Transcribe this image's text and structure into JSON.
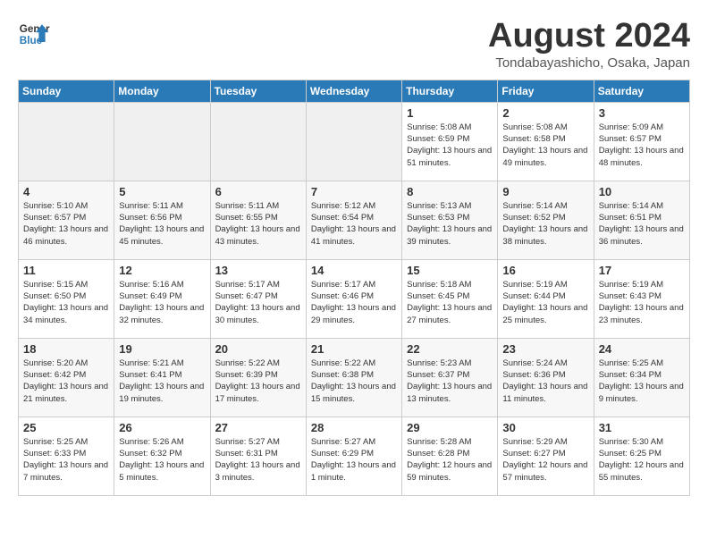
{
  "header": {
    "logo_line1": "General",
    "logo_line2": "Blue",
    "month_title": "August 2024",
    "location": "Tondabayashicho, Osaka, Japan"
  },
  "weekdays": [
    "Sunday",
    "Monday",
    "Tuesday",
    "Wednesday",
    "Thursday",
    "Friday",
    "Saturday"
  ],
  "weeks": [
    [
      {
        "day": "",
        "empty": true
      },
      {
        "day": "",
        "empty": true
      },
      {
        "day": "",
        "empty": true
      },
      {
        "day": "",
        "empty": true
      },
      {
        "day": "1",
        "sunrise": "Sunrise: 5:08 AM",
        "sunset": "Sunset: 6:59 PM",
        "daylight": "Daylight: 13 hours and 51 minutes."
      },
      {
        "day": "2",
        "sunrise": "Sunrise: 5:08 AM",
        "sunset": "Sunset: 6:58 PM",
        "daylight": "Daylight: 13 hours and 49 minutes."
      },
      {
        "day": "3",
        "sunrise": "Sunrise: 5:09 AM",
        "sunset": "Sunset: 6:57 PM",
        "daylight": "Daylight: 13 hours and 48 minutes."
      }
    ],
    [
      {
        "day": "4",
        "sunrise": "Sunrise: 5:10 AM",
        "sunset": "Sunset: 6:57 PM",
        "daylight": "Daylight: 13 hours and 46 minutes."
      },
      {
        "day": "5",
        "sunrise": "Sunrise: 5:11 AM",
        "sunset": "Sunset: 6:56 PM",
        "daylight": "Daylight: 13 hours and 45 minutes."
      },
      {
        "day": "6",
        "sunrise": "Sunrise: 5:11 AM",
        "sunset": "Sunset: 6:55 PM",
        "daylight": "Daylight: 13 hours and 43 minutes."
      },
      {
        "day": "7",
        "sunrise": "Sunrise: 5:12 AM",
        "sunset": "Sunset: 6:54 PM",
        "daylight": "Daylight: 13 hours and 41 minutes."
      },
      {
        "day": "8",
        "sunrise": "Sunrise: 5:13 AM",
        "sunset": "Sunset: 6:53 PM",
        "daylight": "Daylight: 13 hours and 39 minutes."
      },
      {
        "day": "9",
        "sunrise": "Sunrise: 5:14 AM",
        "sunset": "Sunset: 6:52 PM",
        "daylight": "Daylight: 13 hours and 38 minutes."
      },
      {
        "day": "10",
        "sunrise": "Sunrise: 5:14 AM",
        "sunset": "Sunset: 6:51 PM",
        "daylight": "Daylight: 13 hours and 36 minutes."
      }
    ],
    [
      {
        "day": "11",
        "sunrise": "Sunrise: 5:15 AM",
        "sunset": "Sunset: 6:50 PM",
        "daylight": "Daylight: 13 hours and 34 minutes."
      },
      {
        "day": "12",
        "sunrise": "Sunrise: 5:16 AM",
        "sunset": "Sunset: 6:49 PM",
        "daylight": "Daylight: 13 hours and 32 minutes."
      },
      {
        "day": "13",
        "sunrise": "Sunrise: 5:17 AM",
        "sunset": "Sunset: 6:47 PM",
        "daylight": "Daylight: 13 hours and 30 minutes."
      },
      {
        "day": "14",
        "sunrise": "Sunrise: 5:17 AM",
        "sunset": "Sunset: 6:46 PM",
        "daylight": "Daylight: 13 hours and 29 minutes."
      },
      {
        "day": "15",
        "sunrise": "Sunrise: 5:18 AM",
        "sunset": "Sunset: 6:45 PM",
        "daylight": "Daylight: 13 hours and 27 minutes."
      },
      {
        "day": "16",
        "sunrise": "Sunrise: 5:19 AM",
        "sunset": "Sunset: 6:44 PM",
        "daylight": "Daylight: 13 hours and 25 minutes."
      },
      {
        "day": "17",
        "sunrise": "Sunrise: 5:19 AM",
        "sunset": "Sunset: 6:43 PM",
        "daylight": "Daylight: 13 hours and 23 minutes."
      }
    ],
    [
      {
        "day": "18",
        "sunrise": "Sunrise: 5:20 AM",
        "sunset": "Sunset: 6:42 PM",
        "daylight": "Daylight: 13 hours and 21 minutes."
      },
      {
        "day": "19",
        "sunrise": "Sunrise: 5:21 AM",
        "sunset": "Sunset: 6:41 PM",
        "daylight": "Daylight: 13 hours and 19 minutes."
      },
      {
        "day": "20",
        "sunrise": "Sunrise: 5:22 AM",
        "sunset": "Sunset: 6:39 PM",
        "daylight": "Daylight: 13 hours and 17 minutes."
      },
      {
        "day": "21",
        "sunrise": "Sunrise: 5:22 AM",
        "sunset": "Sunset: 6:38 PM",
        "daylight": "Daylight: 13 hours and 15 minutes."
      },
      {
        "day": "22",
        "sunrise": "Sunrise: 5:23 AM",
        "sunset": "Sunset: 6:37 PM",
        "daylight": "Daylight: 13 hours and 13 minutes."
      },
      {
        "day": "23",
        "sunrise": "Sunrise: 5:24 AM",
        "sunset": "Sunset: 6:36 PM",
        "daylight": "Daylight: 13 hours and 11 minutes."
      },
      {
        "day": "24",
        "sunrise": "Sunrise: 5:25 AM",
        "sunset": "Sunset: 6:34 PM",
        "daylight": "Daylight: 13 hours and 9 minutes."
      }
    ],
    [
      {
        "day": "25",
        "sunrise": "Sunrise: 5:25 AM",
        "sunset": "Sunset: 6:33 PM",
        "daylight": "Daylight: 13 hours and 7 minutes."
      },
      {
        "day": "26",
        "sunrise": "Sunrise: 5:26 AM",
        "sunset": "Sunset: 6:32 PM",
        "daylight": "Daylight: 13 hours and 5 minutes."
      },
      {
        "day": "27",
        "sunrise": "Sunrise: 5:27 AM",
        "sunset": "Sunset: 6:31 PM",
        "daylight": "Daylight: 13 hours and 3 minutes."
      },
      {
        "day": "28",
        "sunrise": "Sunrise: 5:27 AM",
        "sunset": "Sunset: 6:29 PM",
        "daylight": "Daylight: 13 hours and 1 minute."
      },
      {
        "day": "29",
        "sunrise": "Sunrise: 5:28 AM",
        "sunset": "Sunset: 6:28 PM",
        "daylight": "Daylight: 12 hours and 59 minutes."
      },
      {
        "day": "30",
        "sunrise": "Sunrise: 5:29 AM",
        "sunset": "Sunset: 6:27 PM",
        "daylight": "Daylight: 12 hours and 57 minutes."
      },
      {
        "day": "31",
        "sunrise": "Sunrise: 5:30 AM",
        "sunset": "Sunset: 6:25 PM",
        "daylight": "Daylight: 12 hours and 55 minutes."
      }
    ]
  ]
}
